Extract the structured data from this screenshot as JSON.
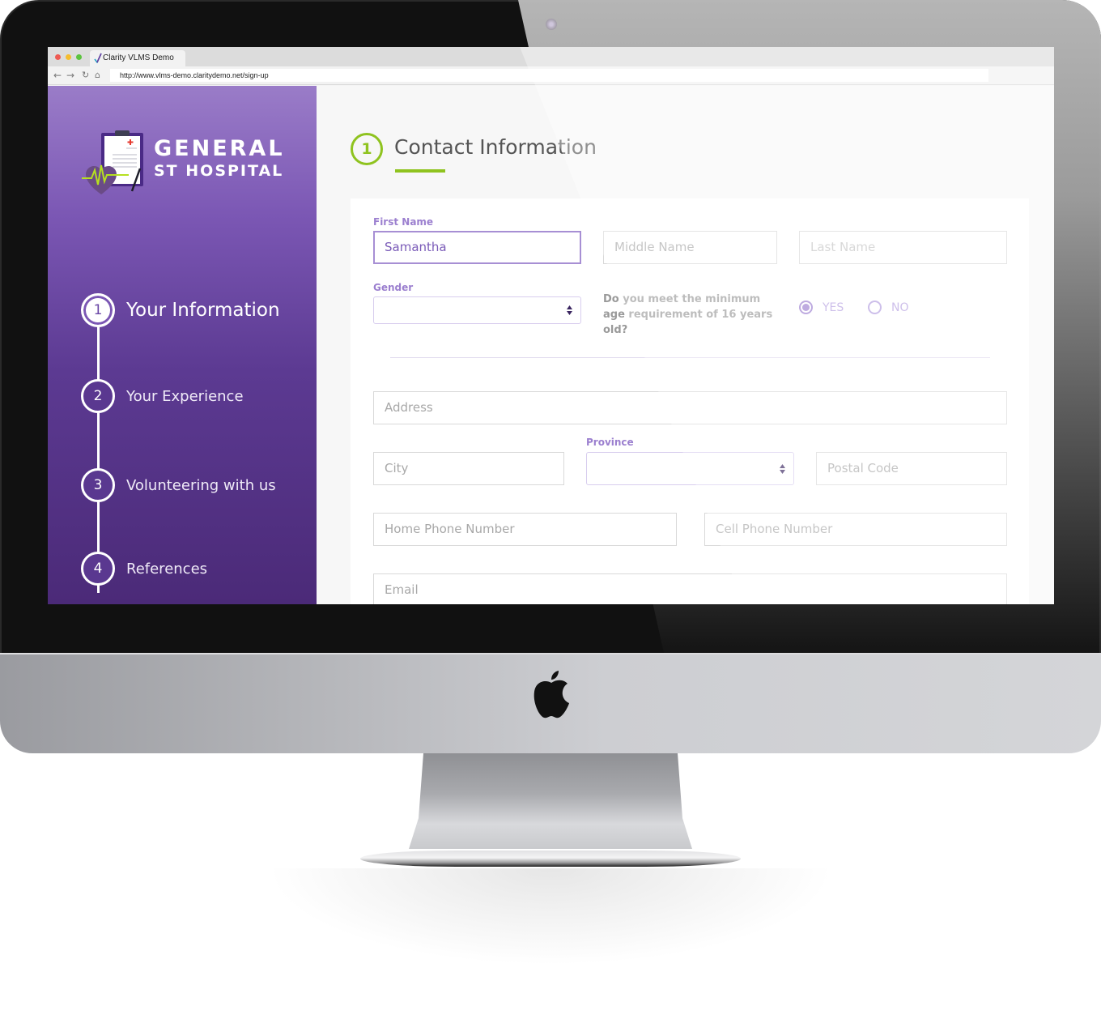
{
  "browser": {
    "tab_title": "Clarity VLMS Demo",
    "url": "http://www.vlms-demo.claritydemo.net/sign-up",
    "nav_icons": [
      "back-arrow-icon",
      "forward-arrow-icon",
      "reload-icon",
      "home-icon"
    ]
  },
  "sidebar": {
    "brand_line1": "GENERAL",
    "brand_line2": "ST HOSPITAL",
    "steps": [
      {
        "number": "1",
        "label": "Your Information",
        "active": true
      },
      {
        "number": "2",
        "label": "Your Experience",
        "active": false
      },
      {
        "number": "3",
        "label": "Volunteering with us",
        "active": false
      },
      {
        "number": "4",
        "label": "References",
        "active": false
      }
    ]
  },
  "main": {
    "section_number": "1",
    "section_title": "Contact Information",
    "form": {
      "first_name": {
        "label": "First Name",
        "value": "Samantha"
      },
      "middle_name": {
        "placeholder": "Middle Name"
      },
      "last_name": {
        "placeholder": "Last Name"
      },
      "gender": {
        "label": "Gender",
        "value": ""
      },
      "age_question": "Do you meet the minimum age requirement of 16 years old?",
      "age_options": [
        {
          "label": "YES",
          "checked": true
        },
        {
          "label": "NO",
          "checked": false
        }
      ],
      "address": {
        "placeholder": "Address"
      },
      "city": {
        "placeholder": "City"
      },
      "province": {
        "label": "Province",
        "value": ""
      },
      "postal_code": {
        "placeholder": "Postal Code"
      },
      "home_phone": {
        "placeholder": "Home Phone Number"
      },
      "cell_phone": {
        "placeholder": "Cell Phone Number"
      },
      "email": {
        "placeholder": "Email"
      }
    }
  },
  "colors": {
    "accent_purple": "#9b7fcf",
    "accent_green": "#8fc31f",
    "sidebar_top": "#9a7cc8",
    "sidebar_bottom": "#4b2a78"
  }
}
